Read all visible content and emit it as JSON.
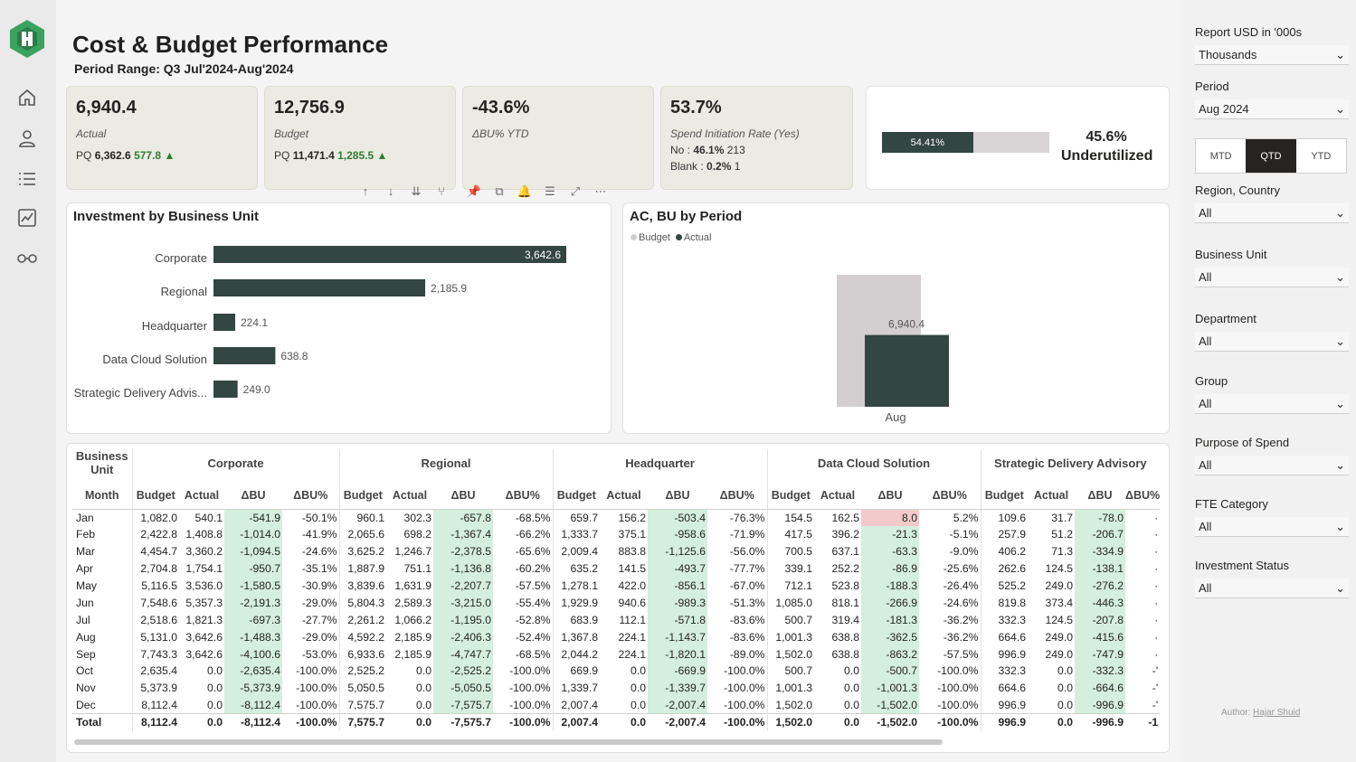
{
  "header": {
    "title": "Cost & Budget Performance",
    "subtitle": "Period Range: Q3 Jul'2024-Aug'2024"
  },
  "nav": [
    {
      "icon": "home-icon"
    },
    {
      "icon": "user-icon"
    },
    {
      "icon": "list-icon"
    },
    {
      "icon": "chart-icon"
    },
    {
      "icon": "glasses-icon"
    }
  ],
  "kpis": {
    "actual": {
      "value": "6,940.4",
      "label": "Actual",
      "pq_label": "PQ",
      "pq_value": "6,362.6",
      "pq_delta": "577.8 ▲"
    },
    "budget": {
      "value": "12,756.9",
      "label": "Budget",
      "pq_label": "PQ",
      "pq_value": "11,471.4",
      "pq_delta": "1,285.5 ▲"
    },
    "delta": {
      "value": "-43.6%",
      "label": "ΔBU% YTD"
    },
    "spend": {
      "value": "53.7%",
      "label": "Spend Initiation Rate (Yes)",
      "no_label": "No :",
      "no_pct": "46.1%",
      "no_count": "213",
      "blank_label": "Blank :",
      "blank_pct": "0.2%",
      "blank_count": "1"
    }
  },
  "gauge": {
    "fill_label": "54.41%",
    "fill_fraction": 0.5441,
    "percent": "45.6%",
    "status": "Underutilized"
  },
  "toolbar": [
    "↑",
    "↓",
    "⇊",
    "⅄",
    "✎",
    "⎘",
    "🔔",
    "≡",
    "⤢",
    "⋯"
  ],
  "investment_chart": {
    "title": "Investment by Business Unit",
    "chart_data": {
      "type": "bar",
      "orientation": "horizontal",
      "categories": [
        "Corporate",
        "Regional",
        "Headquarter",
        "Data Cloud Solution",
        "Strategic Delivery Advis..."
      ],
      "values": [
        3642.6,
        2185.9,
        224.1,
        638.8,
        249.0
      ],
      "labels": [
        "3,642.6",
        "2,185.9",
        "224.1",
        "638.8",
        "249.0"
      ],
      "color": "#334641"
    }
  },
  "period_chart": {
    "title": "AC, BU by Period",
    "legend": [
      {
        "name": "Budget",
        "color": "#d3cfd0"
      },
      {
        "name": "Actual",
        "color": "#334641"
      }
    ],
    "chart_data": {
      "type": "bar",
      "categories": [
        "Aug"
      ],
      "series": [
        {
          "name": "Budget",
          "values": [
            12756.9
          ]
        },
        {
          "name": "Actual",
          "values": [
            6940.4
          ]
        }
      ],
      "data_label": "6,940.4"
    }
  },
  "matrix": {
    "row_header": [
      "Business",
      "Unit",
      "Month"
    ],
    "groups": [
      "Corporate",
      "Regional",
      "Headquarter",
      "Data Cloud Solution",
      "Strategic Delivery Advisory"
    ],
    "columns": [
      "Budget",
      "Actual",
      "ΔBU",
      "ΔBU%"
    ],
    "rows": [
      {
        "m": "Jan",
        "v": [
          [
            "1,082.0",
            "540.1",
            "-541.9",
            "-50.1%"
          ],
          [
            "960.1",
            "302.3",
            "-657.8",
            "-68.5%"
          ],
          [
            "659.7",
            "156.2",
            "-503.4",
            "-76.3%"
          ],
          [
            "154.5",
            "162.5",
            "8.0",
            "5.2%"
          ],
          [
            "109.6",
            "31.7",
            "-78.0",
            "·"
          ]
        ]
      },
      {
        "m": "Feb",
        "v": [
          [
            "2,422.8",
            "1,408.8",
            "-1,014.0",
            "-41.9%"
          ],
          [
            "2,065.6",
            "698.2",
            "-1,367.4",
            "-66.2%"
          ],
          [
            "1,333.7",
            "375.1",
            "-958.6",
            "-71.9%"
          ],
          [
            "417.5",
            "396.2",
            "-21.3",
            "-5.1%"
          ],
          [
            "257.9",
            "51.2",
            "-206.7",
            "·"
          ]
        ]
      },
      {
        "m": "Mar",
        "v": [
          [
            "4,454.7",
            "3,360.2",
            "-1,094.5",
            "-24.6%"
          ],
          [
            "3,625.2",
            "1,246.7",
            "-2,378.5",
            "-65.6%"
          ],
          [
            "2,009.4",
            "883.8",
            "-1,125.6",
            "-56.0%"
          ],
          [
            "700.5",
            "637.1",
            "-63.3",
            "-9.0%"
          ],
          [
            "406.2",
            "71.3",
            "-334.9",
            "·"
          ]
        ]
      },
      {
        "m": "Apr",
        "v": [
          [
            "2,704.8",
            "1,754.1",
            "-950.7",
            "-35.1%"
          ],
          [
            "1,887.9",
            "751.1",
            "-1,136.8",
            "-60.2%"
          ],
          [
            "635.2",
            "141.5",
            "-493.7",
            "-77.7%"
          ],
          [
            "339.1",
            "252.2",
            "-86.9",
            "-25.6%"
          ],
          [
            "262.6",
            "124.5",
            "-138.1",
            "·"
          ]
        ]
      },
      {
        "m": "May",
        "v": [
          [
            "5,116.5",
            "3,536.0",
            "-1,580.5",
            "-30.9%"
          ],
          [
            "3,839.6",
            "1,631.9",
            "-2,207.7",
            "-57.5%"
          ],
          [
            "1,278.1",
            "422.0",
            "-856.1",
            "-67.0%"
          ],
          [
            "712.1",
            "523.8",
            "-188.3",
            "-26.4%"
          ],
          [
            "525.2",
            "249.0",
            "-276.2",
            "·"
          ]
        ]
      },
      {
        "m": "Jun",
        "v": [
          [
            "7,548.6",
            "5,357.3",
            "-2,191.3",
            "-29.0%"
          ],
          [
            "5,804.3",
            "2,589.3",
            "-3,215.0",
            "-55.4%"
          ],
          [
            "1,929.9",
            "940.6",
            "-989.3",
            "-51.3%"
          ],
          [
            "1,085.0",
            "818.1",
            "-266.9",
            "-24.6%"
          ],
          [
            "819.8",
            "373.4",
            "-446.3",
            "·"
          ]
        ]
      },
      {
        "m": "Jul",
        "v": [
          [
            "2,518.6",
            "1,821.3",
            "-697.3",
            "-27.7%"
          ],
          [
            "2,261.2",
            "1,066.2",
            "-1,195.0",
            "-52.8%"
          ],
          [
            "683.9",
            "112.1",
            "-571.8",
            "-83.6%"
          ],
          [
            "500.7",
            "319.4",
            "-181.3",
            "-36.2%"
          ],
          [
            "332.3",
            "124.5",
            "-207.8",
            "·"
          ]
        ]
      },
      {
        "m": "Aug",
        "v": [
          [
            "5,131.0",
            "3,642.6",
            "-1,488.3",
            "-29.0%"
          ],
          [
            "4,592.2",
            "2,185.9",
            "-2,406.3",
            "-52.4%"
          ],
          [
            "1,367.8",
            "224.1",
            "-1,143.7",
            "-83.6%"
          ],
          [
            "1,001.3",
            "638.8",
            "-362.5",
            "-36.2%"
          ],
          [
            "664.6",
            "249.0",
            "-415.6",
            "·"
          ]
        ]
      },
      {
        "m": "Sep",
        "v": [
          [
            "7,743.3",
            "3,642.6",
            "-4,100.6",
            "-53.0%"
          ],
          [
            "6,933.6",
            "2,185.9",
            "-4,747.7",
            "-68.5%"
          ],
          [
            "2,044.2",
            "224.1",
            "-1,820.1",
            "-89.0%"
          ],
          [
            "1,502.0",
            "638.8",
            "-863.2",
            "-57.5%"
          ],
          [
            "996.9",
            "249.0",
            "-747.9",
            "·"
          ]
        ]
      },
      {
        "m": "Oct",
        "v": [
          [
            "2,635.4",
            "0.0",
            "-2,635.4",
            "-100.0%"
          ],
          [
            "2,525.2",
            "0.0",
            "-2,525.2",
            "-100.0%"
          ],
          [
            "669.9",
            "0.0",
            "-669.9",
            "-100.0%"
          ],
          [
            "500.7",
            "0.0",
            "-500.7",
            "-100.0%"
          ],
          [
            "332.3",
            "0.0",
            "-332.3",
            "-'"
          ]
        ]
      },
      {
        "m": "Nov",
        "v": [
          [
            "5,373.9",
            "0.0",
            "-5,373.9",
            "-100.0%"
          ],
          [
            "5,050.5",
            "0.0",
            "-5,050.5",
            "-100.0%"
          ],
          [
            "1,339.7",
            "0.0",
            "-1,339.7",
            "-100.0%"
          ],
          [
            "1,001.3",
            "0.0",
            "-1,001.3",
            "-100.0%"
          ],
          [
            "664.6",
            "0.0",
            "-664.6",
            "-'"
          ]
        ]
      },
      {
        "m": "Dec",
        "v": [
          [
            "8,112.4",
            "0.0",
            "-8,112.4",
            "-100.0%"
          ],
          [
            "7,575.7",
            "0.0",
            "-7,575.7",
            "-100.0%"
          ],
          [
            "2,007.4",
            "0.0",
            "-2,007.4",
            "-100.0%"
          ],
          [
            "1,502.0",
            "0.0",
            "-1,502.0",
            "-100.0%"
          ],
          [
            "996.9",
            "0.0",
            "-996.9",
            "-'"
          ]
        ]
      }
    ],
    "total": {
      "m": "Total",
      "v": [
        [
          "8,112.4",
          "0.0",
          "-8,112.4",
          "-100.0%"
        ],
        [
          "7,575.7",
          "0.0",
          "-7,575.7",
          "-100.0%"
        ],
        [
          "2,007.4",
          "0.0",
          "-2,007.4",
          "-100.0%"
        ],
        [
          "1,502.0",
          "0.0",
          "-1,502.0",
          "-100.0%"
        ],
        [
          "996.9",
          "0.0",
          "-996.9",
          "-1"
        ]
      ]
    }
  },
  "filters": {
    "report": {
      "label": "Report USD in '000s",
      "value": "Thousands"
    },
    "period": {
      "label": "Period",
      "value": "Aug 2024"
    },
    "period_toggle": [
      "MTD",
      "QTD",
      "YTD"
    ],
    "period_toggle_active": "QTD",
    "slicers": [
      {
        "label": "Region, Country",
        "value": "All"
      },
      {
        "label": "Business Unit",
        "value": "All"
      },
      {
        "label": "Department",
        "value": "All"
      },
      {
        "label": "Group",
        "value": "All"
      },
      {
        "label": "Purpose of Spend",
        "value": "All"
      },
      {
        "label": "FTE Category",
        "value": "All"
      },
      {
        "label": "Investment Status",
        "value": "All"
      }
    ]
  },
  "author": {
    "label": "Author:",
    "name": "Hajar Shuid"
  }
}
